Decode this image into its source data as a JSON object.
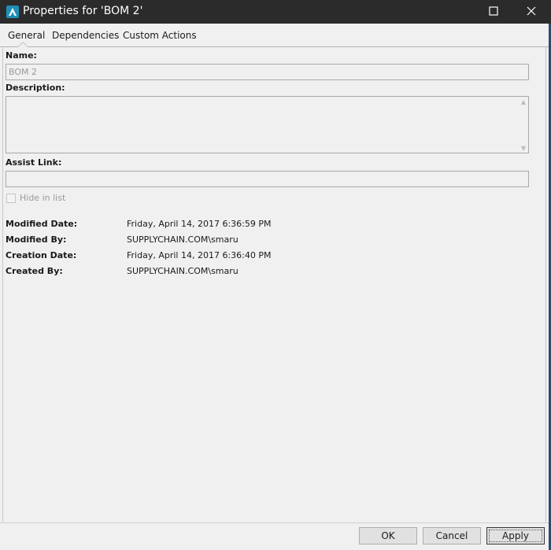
{
  "window": {
    "title": "Properties for 'BOM 2'"
  },
  "tabs": [
    {
      "label": "General"
    },
    {
      "label": "Dependencies"
    },
    {
      "label": "Custom Actions"
    }
  ],
  "form": {
    "name_label": "Name:",
    "name_value": "BOM 2",
    "description_label": "Description:",
    "description_value": "",
    "assist_link_label": "Assist Link:",
    "assist_link_value": "",
    "hide_in_list_label": "Hide in list",
    "hide_in_list_checked": false
  },
  "info": {
    "modified_date_label": "Modified Date:",
    "modified_date_value": "Friday, April 14, 2017 6:36:59 PM",
    "modified_by_label": "Modified By:",
    "modified_by_value": "SUPPLYCHAIN.COM\\smaru",
    "creation_date_label": "Creation Date:",
    "creation_date_value": "Friday, April 14, 2017 6:36:40 PM",
    "created_by_label": "Created By:",
    "created_by_value": "SUPPLYCHAIN.COM\\smaru"
  },
  "buttons": {
    "ok": "OK",
    "cancel": "Cancel",
    "apply": "Apply"
  },
  "icons": {
    "app": "app-logo-icon",
    "maximize": "maximize-icon",
    "close": "close-icon",
    "scroll_up": "scroll-up-icon",
    "scroll_down": "scroll-down-icon"
  },
  "colors": {
    "titlebar": "#2b2b2b",
    "app_icon": "#1f8fb5",
    "window_bg": "#f0f0f0"
  }
}
